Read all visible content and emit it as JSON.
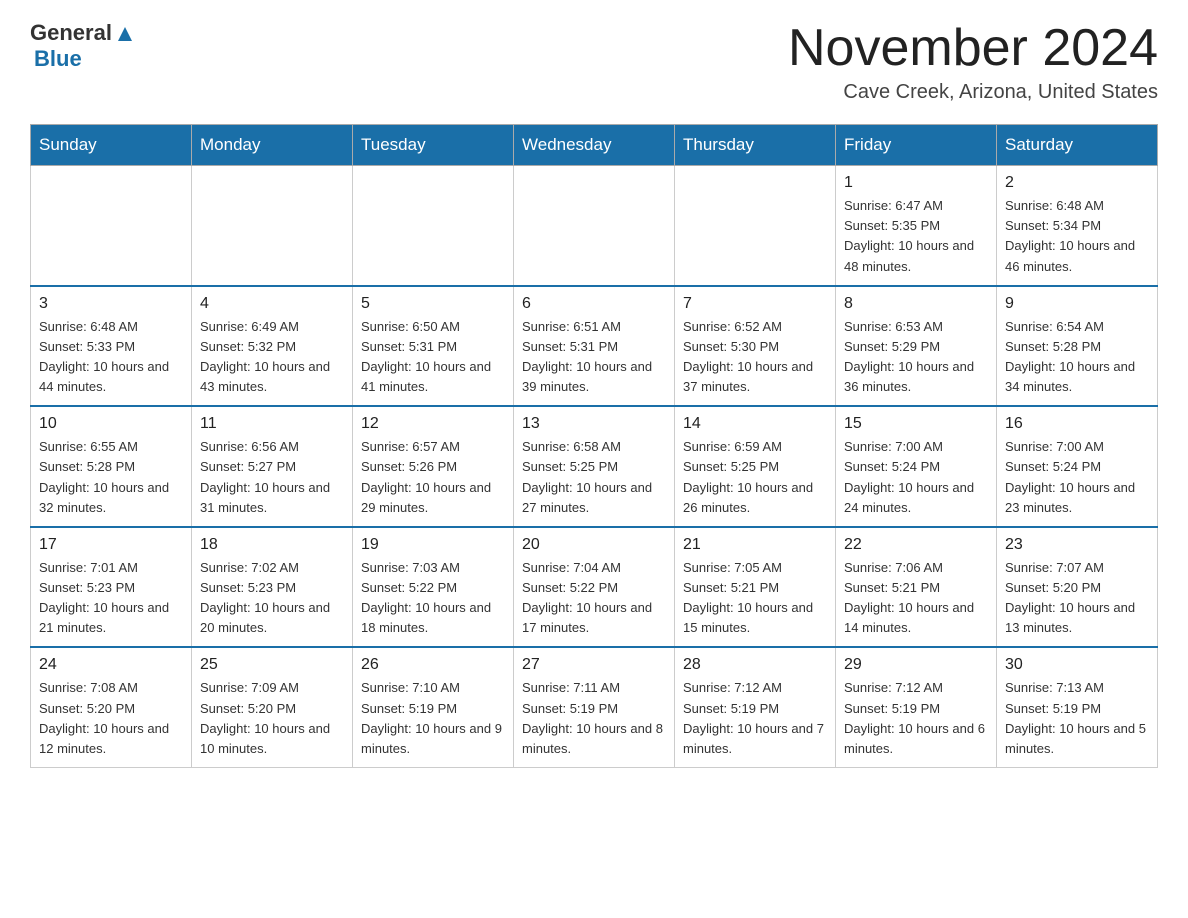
{
  "header": {
    "logo_general": "General",
    "logo_blue": "Blue",
    "month_title": "November 2024",
    "location": "Cave Creek, Arizona, United States"
  },
  "weekdays": [
    "Sunday",
    "Monday",
    "Tuesday",
    "Wednesday",
    "Thursday",
    "Friday",
    "Saturday"
  ],
  "weeks": [
    [
      {
        "day": "",
        "info": ""
      },
      {
        "day": "",
        "info": ""
      },
      {
        "day": "",
        "info": ""
      },
      {
        "day": "",
        "info": ""
      },
      {
        "day": "",
        "info": ""
      },
      {
        "day": "1",
        "info": "Sunrise: 6:47 AM\nSunset: 5:35 PM\nDaylight: 10 hours and 48 minutes."
      },
      {
        "day": "2",
        "info": "Sunrise: 6:48 AM\nSunset: 5:34 PM\nDaylight: 10 hours and 46 minutes."
      }
    ],
    [
      {
        "day": "3",
        "info": "Sunrise: 6:48 AM\nSunset: 5:33 PM\nDaylight: 10 hours and 44 minutes."
      },
      {
        "day": "4",
        "info": "Sunrise: 6:49 AM\nSunset: 5:32 PM\nDaylight: 10 hours and 43 minutes."
      },
      {
        "day": "5",
        "info": "Sunrise: 6:50 AM\nSunset: 5:31 PM\nDaylight: 10 hours and 41 minutes."
      },
      {
        "day": "6",
        "info": "Sunrise: 6:51 AM\nSunset: 5:31 PM\nDaylight: 10 hours and 39 minutes."
      },
      {
        "day": "7",
        "info": "Sunrise: 6:52 AM\nSunset: 5:30 PM\nDaylight: 10 hours and 37 minutes."
      },
      {
        "day": "8",
        "info": "Sunrise: 6:53 AM\nSunset: 5:29 PM\nDaylight: 10 hours and 36 minutes."
      },
      {
        "day": "9",
        "info": "Sunrise: 6:54 AM\nSunset: 5:28 PM\nDaylight: 10 hours and 34 minutes."
      }
    ],
    [
      {
        "day": "10",
        "info": "Sunrise: 6:55 AM\nSunset: 5:28 PM\nDaylight: 10 hours and 32 minutes."
      },
      {
        "day": "11",
        "info": "Sunrise: 6:56 AM\nSunset: 5:27 PM\nDaylight: 10 hours and 31 minutes."
      },
      {
        "day": "12",
        "info": "Sunrise: 6:57 AM\nSunset: 5:26 PM\nDaylight: 10 hours and 29 minutes."
      },
      {
        "day": "13",
        "info": "Sunrise: 6:58 AM\nSunset: 5:25 PM\nDaylight: 10 hours and 27 minutes."
      },
      {
        "day": "14",
        "info": "Sunrise: 6:59 AM\nSunset: 5:25 PM\nDaylight: 10 hours and 26 minutes."
      },
      {
        "day": "15",
        "info": "Sunrise: 7:00 AM\nSunset: 5:24 PM\nDaylight: 10 hours and 24 minutes."
      },
      {
        "day": "16",
        "info": "Sunrise: 7:00 AM\nSunset: 5:24 PM\nDaylight: 10 hours and 23 minutes."
      }
    ],
    [
      {
        "day": "17",
        "info": "Sunrise: 7:01 AM\nSunset: 5:23 PM\nDaylight: 10 hours and 21 minutes."
      },
      {
        "day": "18",
        "info": "Sunrise: 7:02 AM\nSunset: 5:23 PM\nDaylight: 10 hours and 20 minutes."
      },
      {
        "day": "19",
        "info": "Sunrise: 7:03 AM\nSunset: 5:22 PM\nDaylight: 10 hours and 18 minutes."
      },
      {
        "day": "20",
        "info": "Sunrise: 7:04 AM\nSunset: 5:22 PM\nDaylight: 10 hours and 17 minutes."
      },
      {
        "day": "21",
        "info": "Sunrise: 7:05 AM\nSunset: 5:21 PM\nDaylight: 10 hours and 15 minutes."
      },
      {
        "day": "22",
        "info": "Sunrise: 7:06 AM\nSunset: 5:21 PM\nDaylight: 10 hours and 14 minutes."
      },
      {
        "day": "23",
        "info": "Sunrise: 7:07 AM\nSunset: 5:20 PM\nDaylight: 10 hours and 13 minutes."
      }
    ],
    [
      {
        "day": "24",
        "info": "Sunrise: 7:08 AM\nSunset: 5:20 PM\nDaylight: 10 hours and 12 minutes."
      },
      {
        "day": "25",
        "info": "Sunrise: 7:09 AM\nSunset: 5:20 PM\nDaylight: 10 hours and 10 minutes."
      },
      {
        "day": "26",
        "info": "Sunrise: 7:10 AM\nSunset: 5:19 PM\nDaylight: 10 hours and 9 minutes."
      },
      {
        "day": "27",
        "info": "Sunrise: 7:11 AM\nSunset: 5:19 PM\nDaylight: 10 hours and 8 minutes."
      },
      {
        "day": "28",
        "info": "Sunrise: 7:12 AM\nSunset: 5:19 PM\nDaylight: 10 hours and 7 minutes."
      },
      {
        "day": "29",
        "info": "Sunrise: 7:12 AM\nSunset: 5:19 PM\nDaylight: 10 hours and 6 minutes."
      },
      {
        "day": "30",
        "info": "Sunrise: 7:13 AM\nSunset: 5:19 PM\nDaylight: 10 hours and 5 minutes."
      }
    ]
  ]
}
